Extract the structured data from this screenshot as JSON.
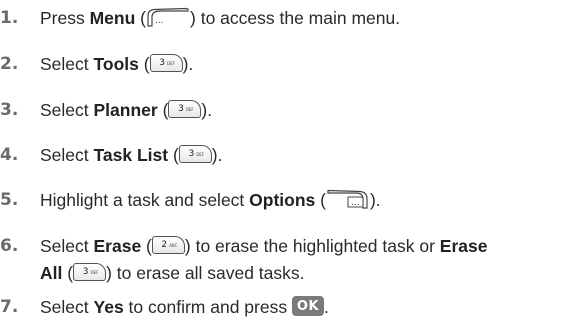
{
  "steps": [
    {
      "num": "1.",
      "a": "Press ",
      "b1": "Menu",
      "c": " (",
      "d": ") to access the main menu."
    },
    {
      "num": "2.",
      "a": "Select ",
      "b1": "Tools",
      "c": " (",
      "key": "3",
      "key_sub": "DEF",
      "d": ")."
    },
    {
      "num": "3.",
      "a": "Select ",
      "b1": "Planner",
      "c": " (",
      "key": "3",
      "key_sub": "DEF",
      "d": ")."
    },
    {
      "num": "4.",
      "a": "Select ",
      "b1": "Task List",
      "c": " (",
      "key": "3",
      "key_sub": "DEF",
      "d": ")."
    },
    {
      "num": "5.",
      "a": "Highlight a task and select ",
      "b1": "Options",
      "c": " (",
      "d": ")."
    },
    {
      "num": "6.",
      "a": "Select ",
      "b1": "Erase",
      "c": " (",
      "key": "2",
      "key_sub": "ABC",
      "d": ") to erase the highlighted task or ",
      "b2": "Erase",
      "line2_b": "All",
      "line2_c": " (",
      "key2": "3",
      "key2_sub": "DEF",
      "line2_d": ") to erase all saved tasks."
    },
    {
      "num": "7.",
      "a": "Select ",
      "b1": "Yes",
      "c": " to confirm and press ",
      "ok": "OK",
      "d": "."
    }
  ]
}
